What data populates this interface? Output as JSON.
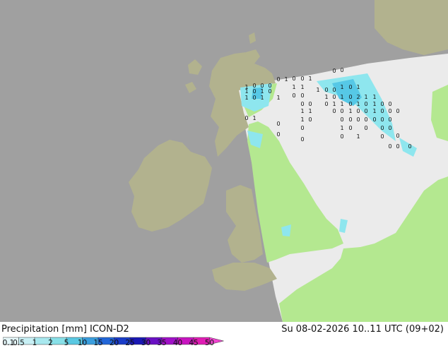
{
  "map": {
    "colors": {
      "sea": "#a0a0a0",
      "land_outside": "#b2b28e",
      "land_inside": "#b4e890",
      "sea_inside": "#ebebeb",
      "rain_light": "#8ee6ee",
      "rain_mid": "#56c8e6"
    },
    "rain_labels": [
      "1",
      "0",
      "0",
      "0",
      "0",
      "1",
      "0",
      "0",
      "1",
      "0",
      "0",
      "1",
      "0",
      "1",
      "0",
      "1",
      "1",
      "1",
      "0",
      "0",
      "1",
      "0",
      "1",
      "1",
      "0",
      "1",
      "1",
      "0",
      "0",
      "1",
      "0",
      "1",
      "0",
      "2",
      "1",
      "1",
      "0",
      "0",
      "0",
      "1",
      "1",
      "0",
      "1",
      "0",
      "1",
      "0",
      "0",
      "0",
      "1",
      "1",
      "1",
      "0",
      "0",
      "1",
      "0",
      "0",
      "1",
      "0",
      "0",
      "0",
      "0",
      "1",
      "0",
      "0",
      "0",
      "0",
      "0",
      "0",
      "0",
      "0",
      "0",
      "0",
      "1",
      "0",
      "0",
      "0",
      "0",
      "0",
      "0",
      "0",
      "1",
      "0",
      "0",
      "0",
      "0",
      "0",
      "0"
    ]
  },
  "footer": {
    "title_left": "Precipitation [mm]  ICON-D2",
    "title_right": "Su 08-02-2026 10..11 UTC (09+02)"
  },
  "legend": {
    "ticks": [
      "0.1",
      "0.5",
      "1",
      "2",
      "5",
      "10",
      "15",
      "20",
      "25",
      "30",
      "35",
      "40",
      "45",
      "50"
    ],
    "colors": [
      "#e6f8fb",
      "#c8f0f5",
      "#a8e8ee",
      "#88e0e8",
      "#5ac8e2",
      "#3a9ede",
      "#2266d8",
      "#1a3cc8",
      "#1a18b4",
      "#6a10c4",
      "#a010c8",
      "#c814c0",
      "#e01cb4",
      "#f044d0"
    ]
  }
}
